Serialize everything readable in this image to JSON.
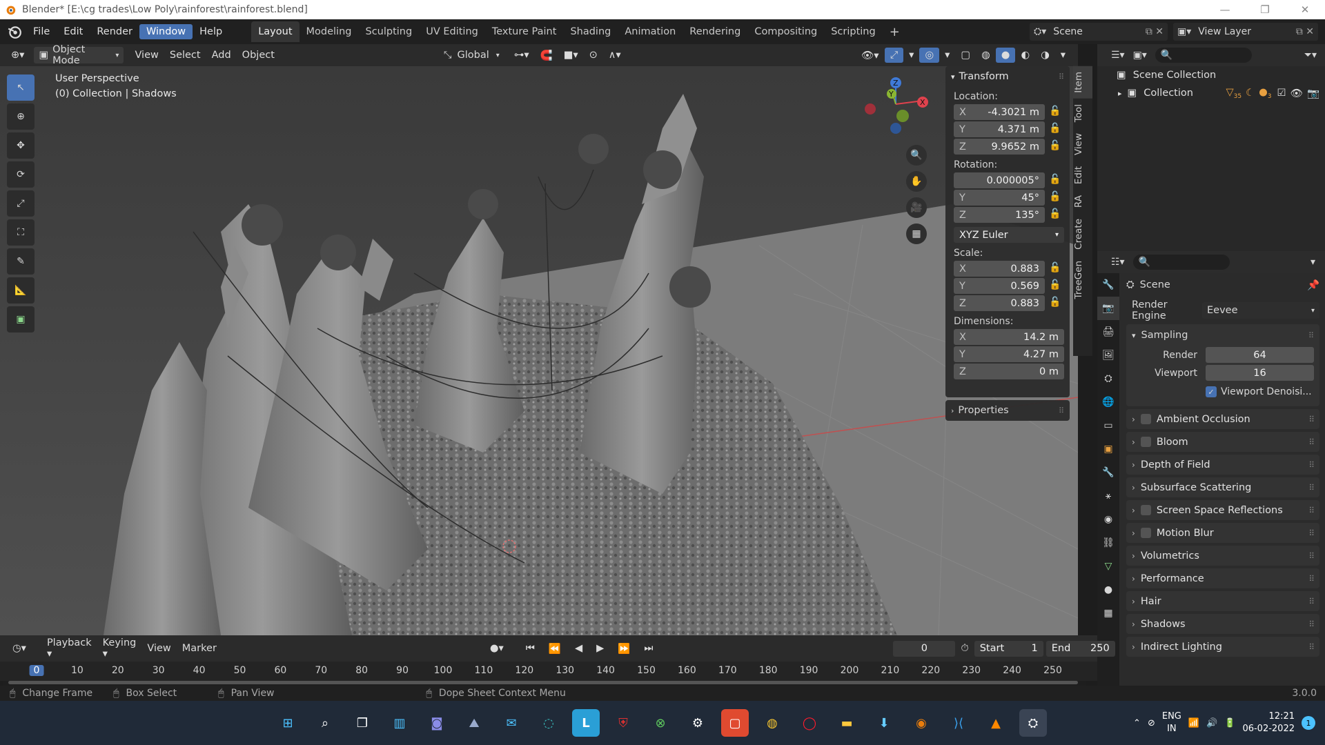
{
  "window": {
    "title": "Blender* [E:\\cg trades\\Low Poly\\rainforest\\rainforest.blend]"
  },
  "menu": [
    "File",
    "Edit",
    "Render",
    "Window",
    "Help"
  ],
  "workspaces": [
    "Layout",
    "Modeling",
    "Sculpting",
    "UV Editing",
    "Texture Paint",
    "Shading",
    "Animation",
    "Rendering",
    "Compositing",
    "Scripting"
  ],
  "scene": {
    "name": "Scene",
    "view_layer": "View Layer"
  },
  "viewport_header": {
    "mode": "Object Mode",
    "view": "View",
    "select": "Select",
    "add": "Add",
    "object": "Object",
    "orientation": "Global"
  },
  "viewport": {
    "perspective": "User Perspective",
    "collection_info": "(0) Collection | Shadows"
  },
  "gizmo": {
    "x": "X",
    "y": "Y",
    "z": "Z"
  },
  "npanel": {
    "transform_title": "Transform",
    "location_label": "Location:",
    "location": [
      {
        "axis": "X",
        "value": "-4.3021 m"
      },
      {
        "axis": "Y",
        "value": "4.371 m"
      },
      {
        "axis": "Z",
        "value": "9.9652 m"
      }
    ],
    "rotation_label": "Rotation:",
    "rotation": [
      {
        "axis": "X",
        "value": "0.000005°"
      },
      {
        "axis": "Y",
        "value": "45°"
      },
      {
        "axis": "Z",
        "value": "135°"
      }
    ],
    "rotation_mode": "XYZ Euler",
    "scale_label": "Scale:",
    "scale": [
      {
        "axis": "X",
        "value": "0.883"
      },
      {
        "axis": "Y",
        "value": "0.569"
      },
      {
        "axis": "Z",
        "value": "0.883"
      }
    ],
    "dimensions_label": "Dimensions:",
    "dimensions": [
      {
        "axis": "X",
        "value": "14.2 m"
      },
      {
        "axis": "Y",
        "value": "4.27 m"
      },
      {
        "axis": "Z",
        "value": "0 m"
      }
    ],
    "properties_title": "Properties"
  },
  "sidebar_tabs": [
    "Item",
    "Tool",
    "View",
    "Edit",
    "RA",
    "Create",
    "TreeGen"
  ],
  "outliner": {
    "scene_collection": "Scene Collection",
    "collection": "Collection",
    "count1": "35",
    "count2": "3"
  },
  "properties": {
    "scene": "Scene",
    "render_engine_label": "Render Engine",
    "render_engine": "Eevee",
    "sampling": "Sampling",
    "render_label": "Render",
    "render_value": "64",
    "viewport_label": "Viewport",
    "viewport_value": "16",
    "viewport_denoise": "Viewport Denoisi...",
    "panels": [
      {
        "label": "Ambient Occlusion",
        "checkbox": true
      },
      {
        "label": "Bloom",
        "checkbox": true
      },
      {
        "label": "Depth of Field",
        "checkbox": false
      },
      {
        "label": "Subsurface Scattering",
        "checkbox": false
      },
      {
        "label": "Screen Space Reflections",
        "checkbox": true
      },
      {
        "label": "Motion Blur",
        "checkbox": true
      },
      {
        "label": "Volumetrics",
        "checkbox": false
      },
      {
        "label": "Performance",
        "checkbox": false
      },
      {
        "label": "Hair",
        "checkbox": false
      },
      {
        "label": "Shadows",
        "checkbox": false
      },
      {
        "label": "Indirect Lighting",
        "checkbox": false
      }
    ]
  },
  "timeline": {
    "playback": "Playback",
    "keying": "Keying",
    "view": "View",
    "marker": "Marker",
    "current_frame": "0",
    "start_label": "Start",
    "start": "1",
    "end_label": "End",
    "end": "250",
    "ticks": [
      "0",
      "10",
      "20",
      "30",
      "40",
      "50",
      "60",
      "70",
      "80",
      "90",
      "100",
      "110",
      "120",
      "130",
      "140",
      "150",
      "160",
      "170",
      "180",
      "190",
      "200",
      "210",
      "220",
      "230",
      "240",
      "250"
    ]
  },
  "statusbar": {
    "change_frame": "Change Frame",
    "box_select": "Box Select",
    "pan_view": "Pan View",
    "context_menu": "Dope Sheet Context Menu",
    "version": "3.0.0"
  },
  "taskbar": {
    "lang1": "ENG",
    "lang2": "IN",
    "time": "12:21",
    "date": "06-02-2022",
    "notif": "1"
  },
  "colors": {
    "accent": "#4772b3",
    "axis_x": "#e0424d",
    "axis_y": "#8bb632",
    "axis_z": "#3f7ad8"
  }
}
